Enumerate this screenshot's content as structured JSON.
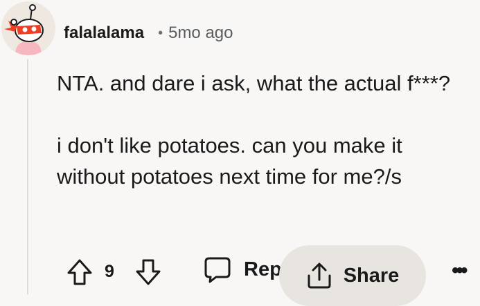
{
  "comment": {
    "username": "falalalama",
    "separator": "•",
    "time": "5mo ago",
    "paragraphs": [
      "NTA. and dare i ask, what the actual f***?",
      "i don't like potatoes. can you make it without potatoes next time for me?/s"
    ]
  },
  "actions": {
    "upvote_icon": "arrow-up-icon",
    "score": "9",
    "downvote_icon": "arrow-down-icon",
    "reply_icon": "comment-bubble-icon",
    "reply_label": "Reply",
    "share_icon": "share-icon",
    "share_label": "Share",
    "more_label": "•••"
  },
  "colors": {
    "background": "#f9f7f5",
    "text": "#1a1a1b",
    "muted": "#5a5d60",
    "share_pill": "#e8e4df",
    "avatar_red": "#ee3e24",
    "avatar_pink": "#f6b7c0"
  }
}
